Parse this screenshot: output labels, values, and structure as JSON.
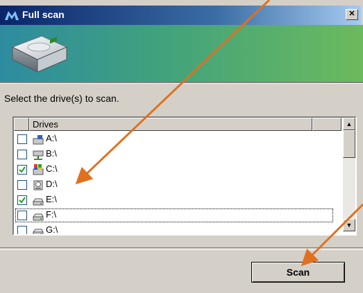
{
  "window": {
    "title": "Full scan",
    "close_glyph": "✕"
  },
  "instruction": "Select the drive(s) to scan.",
  "list": {
    "columns": [
      "",
      "Drives",
      ""
    ],
    "rows": [
      {
        "label": "A:\\",
        "checked": false,
        "icon": "floppy-drive-icon"
      },
      {
        "label": "B:\\",
        "checked": false,
        "icon": "network-drive-icon"
      },
      {
        "label": "C:\\",
        "checked": true,
        "icon": "system-drive-icon"
      },
      {
        "label": "D:\\",
        "checked": false,
        "icon": "cd-drive-icon"
      },
      {
        "label": "E:\\",
        "checked": true,
        "icon": "removable-drive-icon"
      },
      {
        "label": "F:\\",
        "checked": false,
        "icon": "removable-drive-icon"
      },
      {
        "label": "G:\\",
        "checked": false,
        "icon": "removable-drive-icon"
      }
    ]
  },
  "scan_button": {
    "label": "Scan"
  },
  "colors": {
    "annotation_arrow": "#e07020",
    "checkmark": "#21a121",
    "titlebar_start": "#0a246a"
  }
}
